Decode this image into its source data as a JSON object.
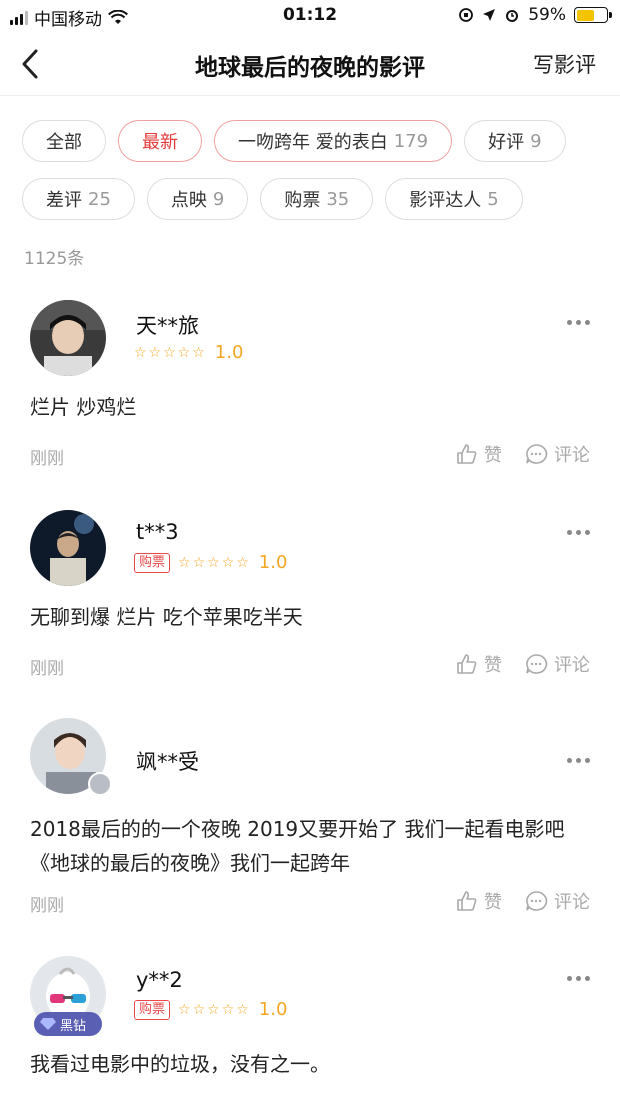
{
  "status_bar": {
    "carrier": "中国移动",
    "time": "01:12",
    "battery": "59%",
    "battery_level": 0.59
  },
  "nav": {
    "title": "地球最后的夜晚的影评",
    "action_label": "写影评"
  },
  "filters": {
    "row1": [
      {
        "label": "全部",
        "count": ""
      },
      {
        "label": "最新",
        "count": ""
      },
      {
        "label": "一吻跨年 爱的表白",
        "count": "179"
      },
      {
        "label": "好评",
        "count": "9"
      }
    ],
    "row2": [
      {
        "label": "差评",
        "count": "25"
      },
      {
        "label": "点映",
        "count": "9"
      },
      {
        "label": "购票",
        "count": "35"
      },
      {
        "label": "影评达人",
        "count": "5"
      }
    ]
  },
  "total_count": "1125条",
  "review_labels": {
    "like": "赞",
    "comment": "评论",
    "ticket_badge": "购票",
    "stars": "☆☆☆☆☆"
  },
  "reviews": [
    {
      "username": "天**旅",
      "has_ticket": false,
      "score": "1.0",
      "content": "烂片 炒鸡烂",
      "time": "刚刚"
    },
    {
      "username": "t**3",
      "has_ticket": true,
      "score": "1.0",
      "content": "无聊到爆 烂片 吃个苹果吃半天",
      "time": "刚刚"
    },
    {
      "username": "飒**受",
      "has_ticket": false,
      "score": "",
      "content": "2018最后的的一个夜晚 2019又要开始了 我们一起看电影吧《地球的最后的夜晚》我们一起跨年",
      "time": "刚刚"
    },
    {
      "username": "y**2",
      "has_ticket": true,
      "score": "1.0",
      "content": "我看过电影中的垃圾，没有之一。",
      "time": "",
      "vip_label": "黑钻"
    }
  ],
  "colors": {
    "accent": "#e53b3b",
    "star": "#f5a623",
    "muted": "#aaaaaa"
  }
}
